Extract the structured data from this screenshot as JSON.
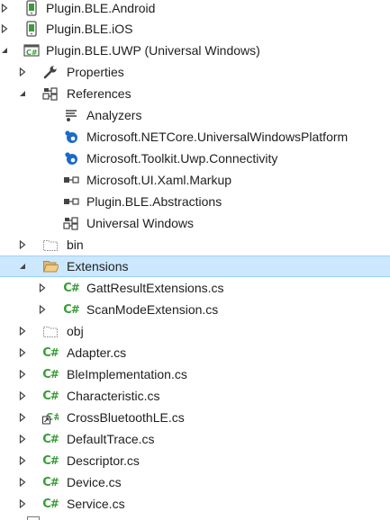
{
  "solution_explorer": {
    "nodes": [
      {
        "label": "Plugin.BLE.Android",
        "icon": "android-project-icon",
        "expander": "collapsed"
      },
      {
        "label": "Plugin.BLE.iOS",
        "icon": "ios-project-icon",
        "expander": "collapsed"
      },
      {
        "label": "Plugin.BLE.UWP (Universal Windows)",
        "icon": "csharp-project-icon",
        "expander": "expanded"
      },
      {
        "label": "Properties",
        "icon": "wrench-icon",
        "expander": "collapsed"
      },
      {
        "label": "References",
        "icon": "references-icon",
        "expander": "expanded"
      },
      {
        "label": "Analyzers",
        "icon": "analyzers-icon",
        "expander": "none"
      },
      {
        "label": "Microsoft.NETCore.UniversalWindowsPlatform",
        "icon": "nuget-package-icon",
        "expander": "none"
      },
      {
        "label": "Microsoft.Toolkit.Uwp.Connectivity",
        "icon": "nuget-package-icon",
        "expander": "none"
      },
      {
        "label": "Microsoft.UI.Xaml.Markup",
        "icon": "assembly-reference-icon",
        "expander": "none"
      },
      {
        "label": "Plugin.BLE.Abstractions",
        "icon": "assembly-reference-icon",
        "expander": "none"
      },
      {
        "label": "Universal Windows",
        "icon": "references-icon",
        "expander": "none"
      },
      {
        "label": "bin",
        "icon": "folder-hidden-icon",
        "expander": "collapsed"
      },
      {
        "label": "Extensions",
        "icon": "folder-open-icon",
        "expander": "expanded",
        "selected": true
      },
      {
        "label": "GattResultExtensions.cs",
        "icon": "csharp-file-icon",
        "expander": "collapsed"
      },
      {
        "label": "ScanModeExtension.cs",
        "icon": "csharp-file-icon",
        "expander": "collapsed"
      },
      {
        "label": "obj",
        "icon": "folder-hidden-icon",
        "expander": "collapsed"
      },
      {
        "label": "Adapter.cs",
        "icon": "csharp-file-icon",
        "expander": "collapsed"
      },
      {
        "label": "BleImplementation.cs",
        "icon": "csharp-file-icon",
        "expander": "collapsed"
      },
      {
        "label": "Characteristic.cs",
        "icon": "csharp-file-icon",
        "expander": "collapsed"
      },
      {
        "label": "CrossBluetoothLE.cs",
        "icon": "csharp-file-shortcut-icon",
        "expander": "collapsed"
      },
      {
        "label": "DefaultTrace.cs",
        "icon": "csharp-file-icon",
        "expander": "collapsed"
      },
      {
        "label": "Descriptor.cs",
        "icon": "csharp-file-icon",
        "expander": "collapsed"
      },
      {
        "label": "Device.cs",
        "icon": "csharp-file-icon",
        "expander": "collapsed"
      },
      {
        "label": "Service.cs",
        "icon": "csharp-file-icon",
        "expander": "collapsed"
      }
    ],
    "colors": {
      "selection_bg": "#cce8ff",
      "selection_border": "#99d1ff",
      "csharp_green": "#389d35",
      "text": "#1e1e1e"
    }
  }
}
